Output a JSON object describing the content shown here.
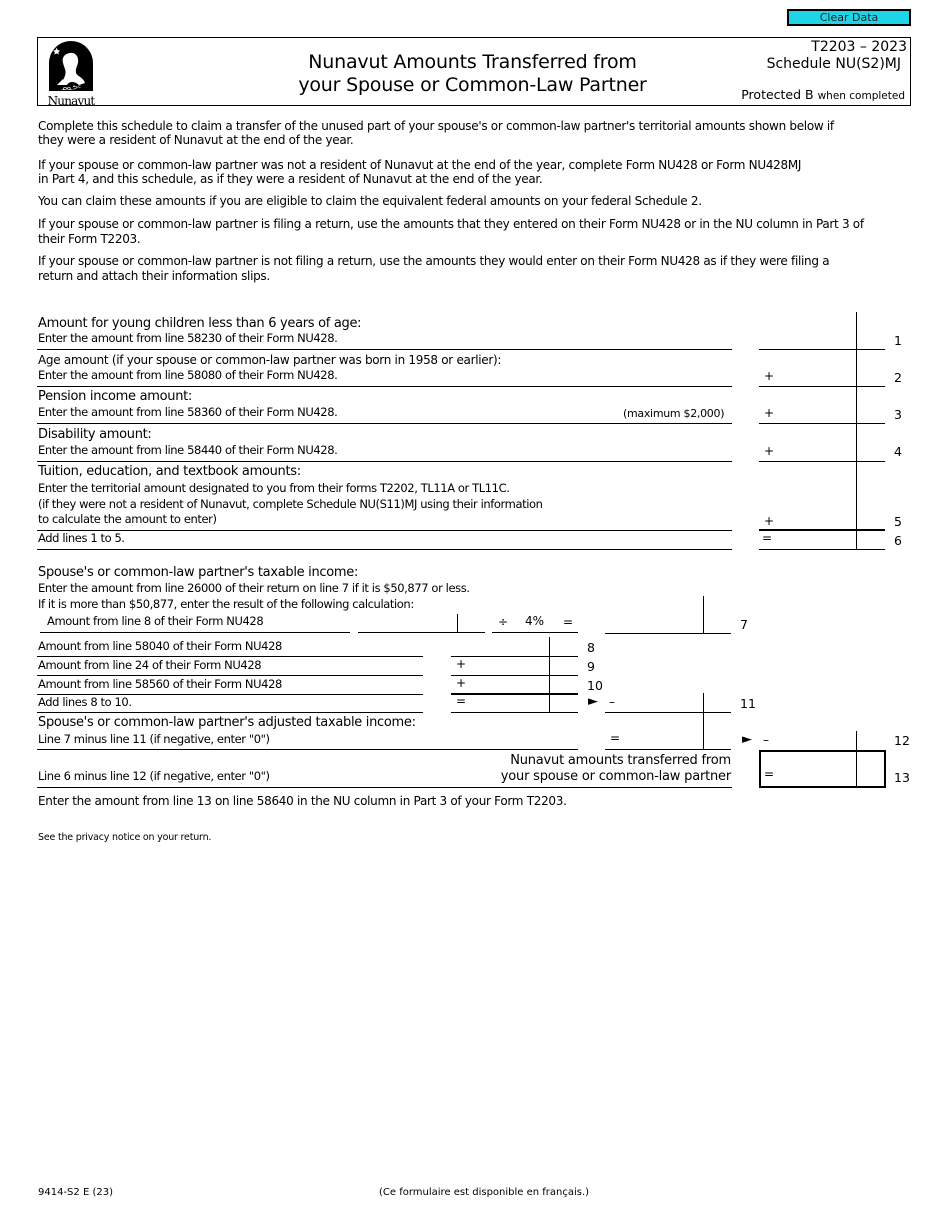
{
  "toolbar": {
    "clear_data_label": "Clear Data"
  },
  "header": {
    "logo_text": "Nunavut",
    "logo_syllabics": "ᓄᓇᕗᑦ",
    "title_line1": "Nunavut Amounts Transferred from",
    "title_line2": "your Spouse or Common-Law Partner",
    "form_id": "T2203 – 2023",
    "schedule": "Schedule NU(S2)MJ",
    "protected": "Protected B",
    "protected_suffix": "when completed"
  },
  "intro": [
    [
      "Complete this schedule to claim a transfer of the unused part of your spouse's or common-law partner's territorial amounts shown below if",
      "they were a resident of Nunavut at the end of the year."
    ],
    [
      "If your spouse or common-law partner was not a resident of Nunavut at the end of the year, complete Form NU428 or Form NU428MJ",
      "in Part 4, and this schedule, as if they were a resident of Nunavut at the end of the year."
    ],
    [
      "You can claim these amounts if you are eligible to claim the equivalent federal amounts on your federal Schedule 2."
    ],
    [
      "If your spouse or common-law partner is filing a return, use the amounts that they entered on their Form NU428 or in the NU column in Part 3 of",
      "their Form T2203."
    ],
    [
      "If your spouse or common-law partner is not filing a return, use the amounts they would enter on their Form NU428 as if they were filing a",
      "return and attach their information slips."
    ]
  ],
  "lines": [
    {
      "number": "1",
      "heading": "Amount for young children less than 6 years of age:",
      "detail": "Enter the amount from line 58230 of their Form NU428.",
      "operator": "",
      "value": ""
    },
    {
      "number": "2",
      "heading": "Age amount (if your spouse or common-law partner was born in 1958 or earlier):",
      "detail": "Enter the amount from line 58080 of their Form NU428.",
      "operator": "+",
      "value": ""
    },
    {
      "number": "3",
      "heading": "Pension income amount:",
      "detail": "Enter the amount from line 58360 of their Form NU428.",
      "note": "(maximum $2,000)",
      "operator": "+",
      "value": ""
    },
    {
      "number": "4",
      "heading": "Disability amount:",
      "detail": "Enter the amount from line 58440 of their Form NU428.",
      "operator": "+",
      "value": ""
    },
    {
      "number": "5",
      "heading": "Tuition, education, and textbook amounts:",
      "detail": "Enter the territorial amount designated to you from their forms T2202, TL11A or TL11C.",
      "detail2": "(if they were not a resident of Nunavut, complete Schedule NU(S11)MJ  using their information",
      "detail3": "to calculate the amount to enter)",
      "operator": "+",
      "value": ""
    },
    {
      "number": "6",
      "detail": "Add lines 1 to 5.",
      "operator": "=",
      "value": ""
    }
  ],
  "income": {
    "heading": "Spouse's or common-law partner's taxable income:",
    "detail1": "Enter the amount from line 26000 of their return on line 7 if it is $50,877 or less.",
    "detail2": "If it is more than $50,877, enter the result of the following calculation:",
    "calc_label": "Amount from line 8 of their Form NU428",
    "divide": "÷",
    "rate": "4%",
    "equals": "=",
    "line7": {
      "number": "7",
      "value": ""
    },
    "sub_lines": [
      {
        "number": "8",
        "label": "Amount from line 58040 of their Form NU428",
        "operator": "",
        "value": ""
      },
      {
        "number": "9",
        "label": "Amount from line 24 of their Form NU428",
        "operator": "+",
        "value": ""
      },
      {
        "number": "10",
        "label": "Amount from line 58560 of their Form NU428",
        "operator": "+",
        "value": ""
      },
      {
        "number": "11",
        "label": "Add lines 8 to 10.",
        "operator": "=",
        "arrow": "►",
        "minus": "–",
        "value": ""
      }
    ],
    "adjusted_heading": "Spouse's or common-law partner's adjusted taxable income:",
    "adjusted_detail": "Line 7 minus line 11 (if negative, enter \"0\")",
    "adjusted_operator": "=",
    "line12": {
      "number": "12",
      "arrow": "►",
      "minus": "–",
      "value": ""
    },
    "line13_label": "Line 6 minus line 12 (if negative, enter \"0\")",
    "line13_title1": "Nunavut amounts transferred from",
    "line13_title2": "your spouse or common-law partner",
    "line13": {
      "number": "13",
      "operator": "=",
      "value": ""
    }
  },
  "closing_instruction": "Enter the amount from line 13 on line 58640 in the NU column in Part 3 of your Form T2203.",
  "privacy_notice": "See the privacy notice on your return.",
  "footer": {
    "form_code": "9414-S2 E (23)",
    "french_note": "(Ce formulaire est disponible en français.)"
  }
}
